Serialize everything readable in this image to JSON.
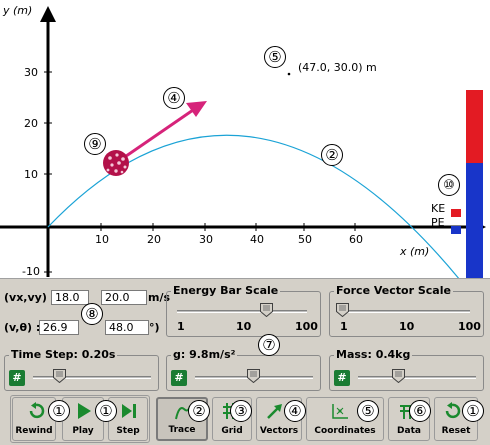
{
  "axes": {
    "y_label": "y (m)",
    "x_label": "x (m)",
    "y_ticks": [
      "30",
      "20",
      "10",
      "-10"
    ],
    "x_ticks": [
      "10",
      "20",
      "30",
      "40",
      "50",
      "60"
    ]
  },
  "coordinate_readout": "(47.0, 30.0) m",
  "energy_bar": {
    "ke_label": "KE",
    "pe_label": "PE",
    "ke_color": "#e31b23",
    "pe_color": "#1835c9",
    "ke_fraction": 0.39,
    "pe_fraction": 0.61
  },
  "colors": {
    "trajectory": "#1ba3d6",
    "vector": "#d6237a",
    "ball": "#b3114a",
    "hash_button": "#1a7c33"
  },
  "callouts": [
    "①",
    "②",
    "③",
    "④",
    "⑤",
    "⑥",
    "⑦",
    "⑧",
    "⑨",
    "⑩"
  ],
  "velocity": {
    "xy_label": "(vx,vy) :",
    "vx": "18.0",
    "vy": "20.0",
    "xy_unit": "m/s",
    "polar_label": "(v,θ) :",
    "v": "26.9",
    "theta": "48.0",
    "polar_unit": "°)"
  },
  "energy_bar_scale": {
    "title": "Energy Bar Scale",
    "ticks": [
      "1",
      "10",
      "100"
    ]
  },
  "force_vector_scale": {
    "title": "Force Vector Scale",
    "ticks": [
      "1",
      "10",
      "100"
    ]
  },
  "time_step": {
    "label": "Time Step: 0.20s"
  },
  "gravity": {
    "label": "g: 9.8m/s²"
  },
  "mass": {
    "label": "Mass: 0.4kg"
  },
  "hash_glyph": "#",
  "buttons": {
    "rewind": "Rewind",
    "play": "Play",
    "step": "Step",
    "trace": "Trace",
    "grid": "Grid",
    "vectors": "Vectors",
    "coordinates": "Coordinates",
    "data": "Data",
    "reset": "Reset"
  }
}
